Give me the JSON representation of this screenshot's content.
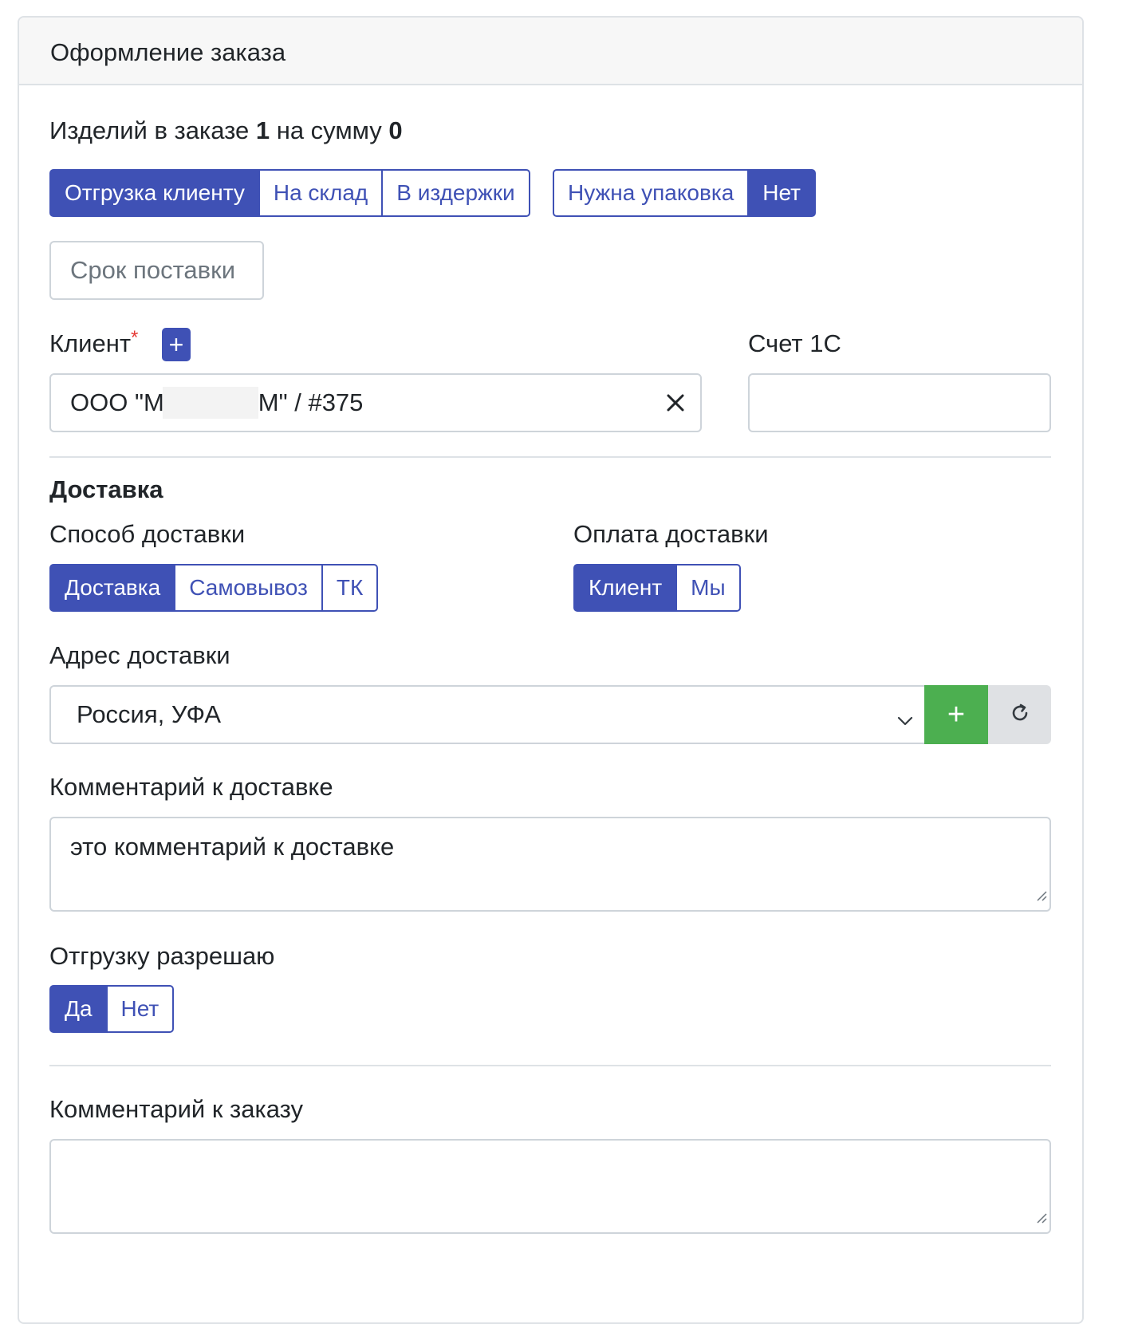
{
  "header": {
    "title": "Оформление заказа"
  },
  "summary": {
    "prefix": "Изделий в заказе ",
    "count": "1",
    "middle": " на сумму ",
    "sum": "0"
  },
  "shipment_mode": {
    "options": [
      "Отгрузка клиенту",
      "На склад",
      "В издержки"
    ],
    "selected": "Отгрузка клиенту"
  },
  "packaging": {
    "label": "Нужна упаковка",
    "value": "Нет"
  },
  "delivery_term_button": "Срок поставки",
  "client": {
    "label": "Клиент",
    "required_mark": "*",
    "add_label": "+",
    "value_prefix": "ООО \"М",
    "value_suffix": "М\" / #375",
    "clear_label": "×"
  },
  "account_1c": {
    "label": "Счет 1С",
    "value": ""
  },
  "delivery": {
    "section_title": "Доставка",
    "method": {
      "label": "Способ доставки",
      "options": [
        "Доставка",
        "Самовывоз",
        "ТК"
      ],
      "selected": "Доставка"
    },
    "payment": {
      "label": "Оплата доставки",
      "options": [
        "Клиент",
        "Мы"
      ],
      "selected": "Клиент"
    },
    "address": {
      "label": "Адрес доставки",
      "value": "Россия, УФА",
      "add_label": "+"
    },
    "comment": {
      "label": "Комментарий к доставке",
      "value": "это комментарий к доставке"
    }
  },
  "shipment_allowed": {
    "label": "Отгрузку разрешаю",
    "options": [
      "Да",
      "Нет"
    ],
    "selected": "Да"
  },
  "order_comment": {
    "label": "Комментарий к заказу",
    "value": ""
  },
  "colors": {
    "primary": "#3f51b5",
    "success": "#4caf50",
    "border": "#ced4da",
    "required": "#e53935"
  }
}
